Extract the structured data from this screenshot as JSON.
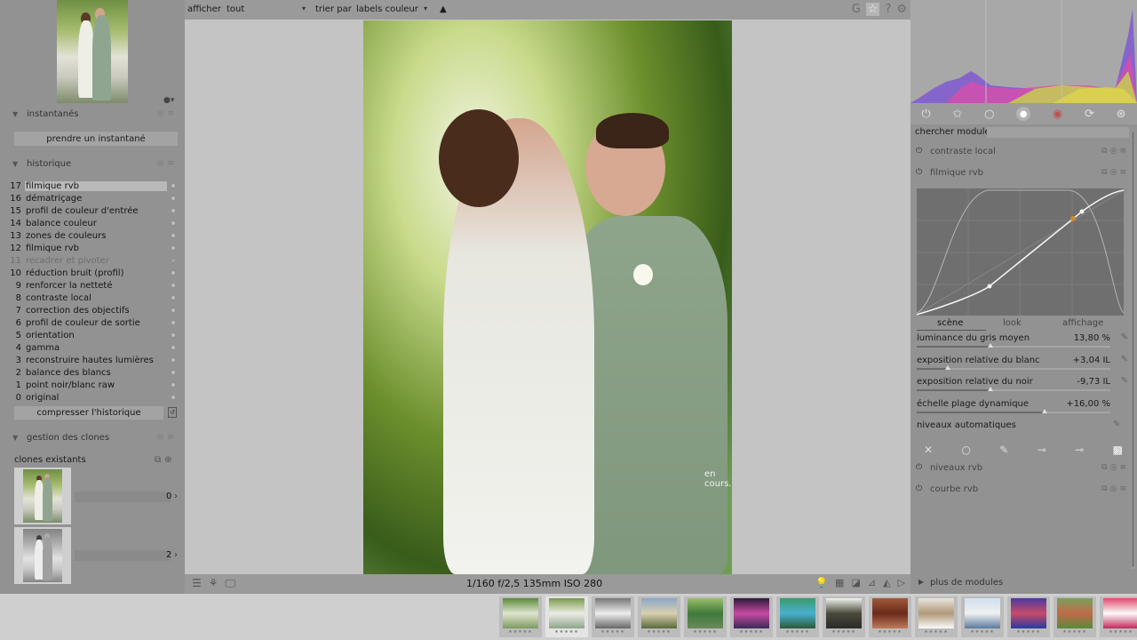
{
  "left_panel": {
    "snapshots": {
      "title": "instantanés",
      "take_button": "prendre un instantané"
    },
    "history": {
      "title": "historique",
      "items": [
        {
          "num": "17",
          "name": "filmique rvb",
          "selected": true,
          "disabled": false
        },
        {
          "num": "16",
          "name": "dématriçage",
          "selected": false,
          "disabled": false
        },
        {
          "num": "15",
          "name": "profil de couleur d'entrée",
          "selected": false,
          "disabled": false
        },
        {
          "num": "14",
          "name": "balance couleur",
          "selected": false,
          "disabled": false
        },
        {
          "num": "13",
          "name": "zones de couleurs",
          "selected": false,
          "disabled": false
        },
        {
          "num": "12",
          "name": "filmique rvb",
          "selected": false,
          "disabled": false
        },
        {
          "num": "11",
          "name": "recadrer et pivoter",
          "selected": false,
          "disabled": true
        },
        {
          "num": "10",
          "name": "réduction bruit (profil)",
          "selected": false,
          "disabled": false
        },
        {
          "num": "9",
          "name": "renforcer la netteté",
          "selected": false,
          "disabled": false
        },
        {
          "num": "8",
          "name": "contraste local",
          "selected": false,
          "disabled": false
        },
        {
          "num": "7",
          "name": "correction des objectifs",
          "selected": false,
          "disabled": false
        },
        {
          "num": "6",
          "name": "profil de couleur de sortie",
          "selected": false,
          "disabled": false
        },
        {
          "num": "5",
          "name": "orientation",
          "selected": false,
          "disabled": false
        },
        {
          "num": "4",
          "name": "gamma",
          "selected": false,
          "disabled": false
        },
        {
          "num": "3",
          "name": "reconstruire hautes lumières",
          "selected": false,
          "disabled": false
        },
        {
          "num": "2",
          "name": "balance des blancs",
          "selected": false,
          "disabled": false
        },
        {
          "num": "1",
          "name": "point noir/blanc raw",
          "selected": false,
          "disabled": false
        },
        {
          "num": "0",
          "name": "original",
          "selected": false,
          "disabled": false
        }
      ],
      "compress_button": "compresser l'historique"
    },
    "clones": {
      "title": "gestion des clones",
      "existing_label": "clones existants",
      "items": [
        {
          "version": "0"
        },
        {
          "version": "2"
        }
      ]
    }
  },
  "topbar": {
    "show_label": "afficher",
    "show_value": "tout",
    "sort_label": "trier par",
    "sort_value": "labels couleur",
    "sort_dir": "▲"
  },
  "center": {
    "working_text": "en cours..."
  },
  "bottombar": {
    "exif": "1/160 f/2,5 135mm ISO 280"
  },
  "right_panel": {
    "search_label": "chercher module",
    "search_placeholder": "",
    "modules": {
      "local_contrast": "contraste local",
      "filmic": "filmique rvb",
      "levels": "niveaux rvb",
      "curve": "courbe rvb"
    },
    "filmic_tabs": [
      "scène",
      "look",
      "affichage"
    ],
    "filmic_tab_active": "scène",
    "sliders": [
      {
        "name": "luminance du gris moyen",
        "value": "13,80 %",
        "fraction": 0.38
      },
      {
        "name": "exposition relative du blanc",
        "value": "+3,04 IL",
        "fraction": 0.16
      },
      {
        "name": "exposition relative du noir",
        "value": "-9,73 IL",
        "fraction": 0.38
      },
      {
        "name": "échelle plage dynamique",
        "value": "+16,00 %",
        "fraction": 0.66
      }
    ],
    "auto_levels": "niveaux automatiques",
    "more_modules": "plus de modules"
  },
  "colors": {
    "accent_point": "#d08a2a"
  },
  "filmstrip": {
    "count": 14,
    "current_index": 1
  }
}
